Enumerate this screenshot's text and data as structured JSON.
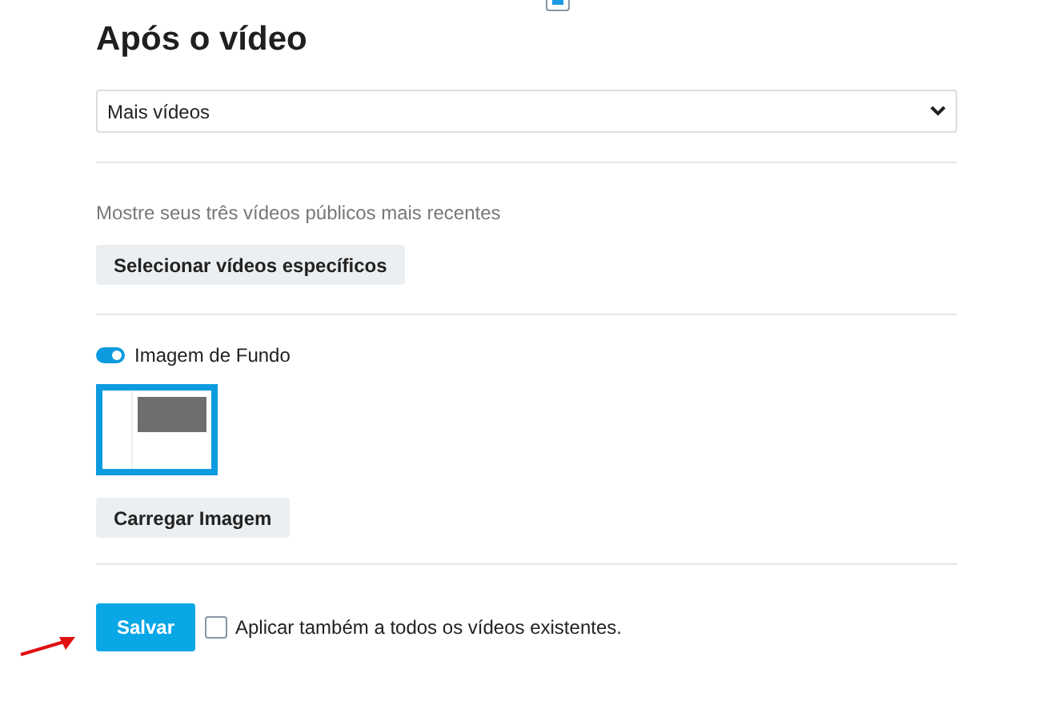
{
  "top_checkbox": {
    "checked": true
  },
  "heading": "Após o vídeo",
  "select": {
    "value": "Mais vídeos"
  },
  "description": "Mostre seus três vídeos públicos mais recentes",
  "select_button": "Selecionar vídeos específicos",
  "background_toggle": {
    "label": "Imagem de Fundo",
    "on": true
  },
  "upload_button": "Carregar Imagem",
  "save_button": "Salvar",
  "apply_all": {
    "label": "Aplicar também a todos os vídeos existentes.",
    "checked": false
  }
}
